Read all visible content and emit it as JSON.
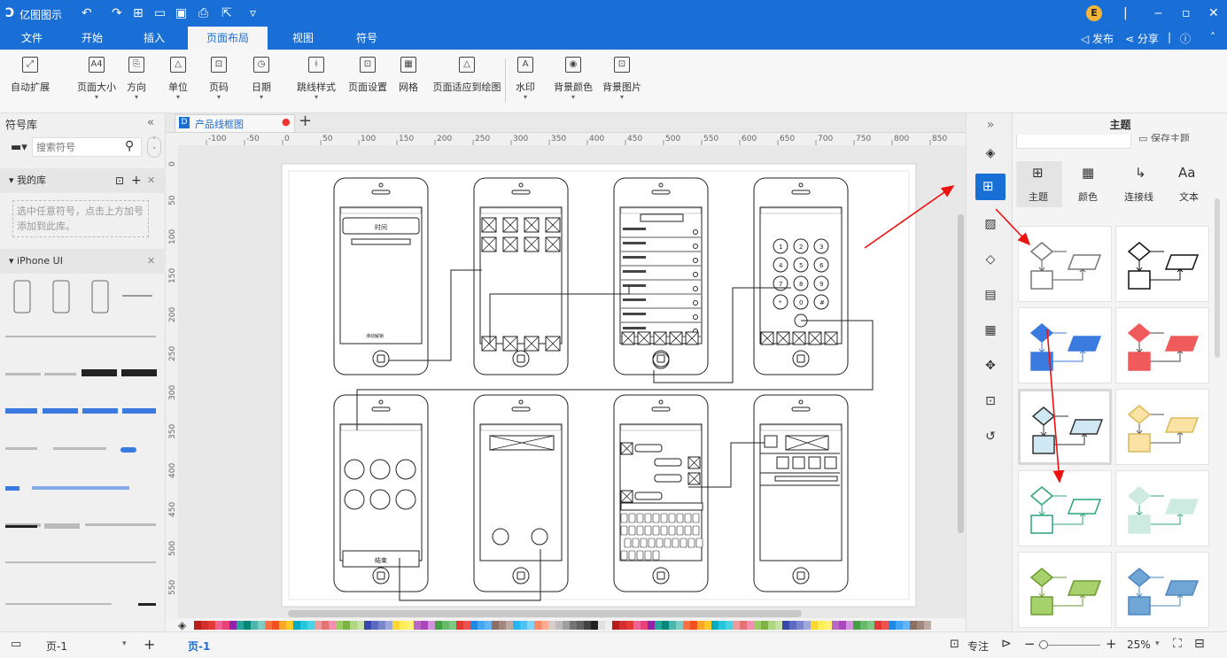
{
  "app": {
    "title": "亿图图示"
  },
  "menu": {
    "tabs": [
      "文件",
      "开始",
      "插入",
      "页面布局",
      "视图",
      "符号"
    ],
    "active": "页面布局"
  },
  "titlebar": {
    "user_initial": "E",
    "publish": "发布",
    "share": "分享"
  },
  "ribbon": {
    "buttons": [
      {
        "label": "自动扩展",
        "icon": "auto-expand-icon",
        "dropdown": false
      },
      {
        "label": "页面大小",
        "icon": "page-size-icon",
        "dropdown": true
      },
      {
        "label": "方向",
        "icon": "orientation-icon",
        "dropdown": true
      },
      {
        "label": "单位",
        "icon": "unit-icon",
        "dropdown": true
      },
      {
        "label": "页码",
        "icon": "page-number-icon",
        "dropdown": true
      },
      {
        "label": "日期",
        "icon": "date-icon",
        "dropdown": true
      },
      {
        "label": "跳线样式",
        "icon": "jump-style-icon",
        "dropdown": true
      },
      {
        "label": "页面设置",
        "icon": "page-setup-icon",
        "dropdown": false
      },
      {
        "label": "网格",
        "icon": "grid-icon",
        "dropdown": false
      },
      {
        "label": "页面适应到绘图",
        "icon": "fit-page-icon",
        "dropdown": false
      },
      {
        "label": "水印",
        "icon": "watermark-icon",
        "dropdown": true
      },
      {
        "label": "背景颜色",
        "icon": "bg-color-icon",
        "dropdown": true
      },
      {
        "label": "背景图片",
        "icon": "bg-image-icon",
        "dropdown": true
      }
    ]
  },
  "library": {
    "title": "符号库",
    "search_placeholder": "搜索符号",
    "my_lib": "我的库",
    "my_lib_hint": "选中任意符号，点击上方加号添加到此库。",
    "iphone_lib": "iPhone UI"
  },
  "document": {
    "tab": "产品线框图"
  },
  "ruler": {
    "labels": [
      "-100",
      "-50",
      "0",
      "50",
      "100",
      "150",
      "200",
      "250",
      "300",
      "350",
      "400",
      "450",
      "500",
      "550",
      "600",
      "650",
      "700",
      "750",
      "800",
      "850"
    ],
    "vlabels": [
      "0",
      "50",
      "100",
      "150",
      "200",
      "250",
      "300",
      "350",
      "400",
      "450",
      "500",
      "550"
    ]
  },
  "wireframes": {
    "time_button": "时间",
    "slide_text": "滑动解锁",
    "call_button": "结束",
    "keypad": [
      "1",
      "2",
      "3",
      "4",
      "5",
      "6",
      "7",
      "8",
      "9",
      "*",
      "0",
      "#"
    ]
  },
  "theme_panel": {
    "title": "主题",
    "save_theme": "保存主题",
    "tabs": [
      "主题",
      "颜色",
      "连接线",
      "文本"
    ],
    "themes": [
      {
        "fill": "#ffffff",
        "stroke": "#777777",
        "line": "#555555"
      },
      {
        "fill": "#ffffff",
        "stroke": "#111111",
        "line": "#111111"
      },
      {
        "fill": "#3b7be0",
        "stroke": "#3b7be0",
        "line": "#3b7be0"
      },
      {
        "fill": "#ef5a5a",
        "stroke": "#ef5a5a",
        "line": "#444444"
      },
      {
        "fill": "#cfe8f3",
        "stroke": "#333333",
        "line": "#333333"
      },
      {
        "fill": "#fbe3a6",
        "stroke": "#d9b95a",
        "line": "#555555"
      },
      {
        "fill": "#ffffff",
        "stroke": "#2aa57a",
        "line": "#2aa57a"
      },
      {
        "fill": "#cdebe0",
        "stroke": "#cdebe0",
        "line": "#2aa57a"
      },
      {
        "fill": "#a6d16c",
        "stroke": "#6f9a32",
        "line": "#6f9a32"
      },
      {
        "fill": "#6fa6d6",
        "stroke": "#4e87bd",
        "line": "#4e87bd"
      }
    ]
  },
  "statusbar": {
    "page_select": "页-1",
    "page_tab": "页-1",
    "focus": "专注",
    "zoom": "25%"
  },
  "colors": {
    "accent": "#1a6fd6",
    "arrow": "#ee1111"
  }
}
